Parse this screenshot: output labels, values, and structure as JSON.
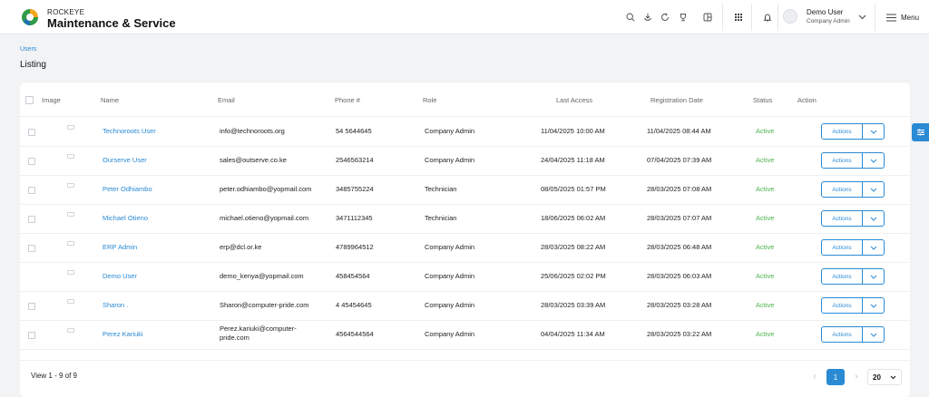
{
  "header": {
    "brand_small": "ROCKEYE",
    "brand_title": "Maintenance & Service",
    "user_name": "Demo User",
    "user_role": "Company Admin",
    "menu_label": "Menu"
  },
  "breadcrumb": "Users",
  "page_title": "Listing",
  "table": {
    "columns": [
      "Image",
      "Name",
      "Email",
      "Phone #",
      "Role",
      "Last Access",
      "Registration Date",
      "Status",
      "Action"
    ],
    "rows": [
      {
        "name": "Technoroots User",
        "email": "info@technoroots.org",
        "phone": "54 5644645",
        "role": "Company Admin",
        "last_access": "11/04/2025 10:00 AM",
        "registered": "11/04/2025 08:44 AM",
        "status": "Active",
        "action": "Actions",
        "checkbox": true
      },
      {
        "name": "Ourserve User",
        "email": "sales@outserve.co.ke",
        "phone": "2546563214",
        "role": "Company Admin",
        "last_access": "24/04/2025 11:18 AM",
        "registered": "07/04/2025 07:39 AM",
        "status": "Active",
        "action": "Actions",
        "checkbox": true
      },
      {
        "name": "Peter Odhiambo",
        "email": "peter.odhiambo@yopmail.com",
        "phone": "3485755224",
        "role": "Technician",
        "last_access": "08/05/2025 01:57 PM",
        "registered": "28/03/2025 07:08 AM",
        "status": "Active",
        "action": "Actions",
        "checkbox": true
      },
      {
        "name": "Michael Otieno",
        "email": "michael.otieno@yopmail.com",
        "phone": "3471112345",
        "role": "Technician",
        "last_access": "18/06/2025 06:02 AM",
        "registered": "28/03/2025 07:07 AM",
        "status": "Active",
        "action": "Actions",
        "checkbox": true
      },
      {
        "name": "ERP Admin",
        "email": "erp@dcl.or.ke",
        "phone": "4789964512",
        "role": "Company Admin",
        "last_access": "28/03/2025 08:22 AM",
        "registered": "28/03/2025 06:48 AM",
        "status": "Active",
        "action": "Actions",
        "checkbox": true
      },
      {
        "name": "Demo User",
        "email": "demo_kenya@yopmail.com",
        "phone": "458454564",
        "role": "Company Admin",
        "last_access": "25/06/2025 02:02 PM",
        "registered": "28/03/2025 06:03 AM",
        "status": "Active",
        "action": "Actions",
        "checkbox": false
      },
      {
        "name": "Sharon .",
        "email": "Sharon@computer-pride.com",
        "phone": "4 45454645",
        "role": "Company Admin",
        "last_access": "28/03/2025 03:39 AM",
        "registered": "28/03/2025 03:28 AM",
        "status": "Active",
        "action": "Actions",
        "checkbox": true
      },
      {
        "name": "Perez Kariuki",
        "email": "Perez.kariuki@computer-pride.com",
        "phone": "4564544564",
        "role": "Company Admin",
        "last_access": "04/04/2025 11:34 AM",
        "registered": "28/03/2025 03:22 AM",
        "status": "Active",
        "action": "Actions",
        "checkbox": true
      }
    ]
  },
  "footer": {
    "view_count": "View 1 - 9 of 9",
    "current_page": "1",
    "page_size": "20"
  },
  "colors": {
    "accent": "#2a8ad4",
    "active_status": "#4db34d"
  }
}
